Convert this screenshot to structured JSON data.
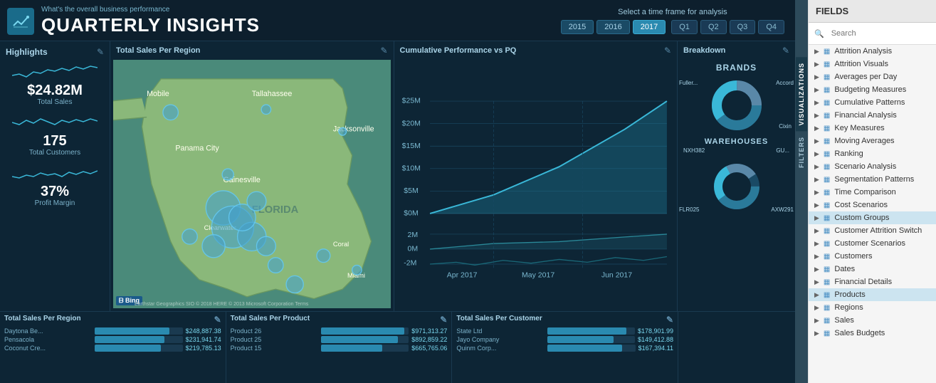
{
  "header": {
    "subtitle": "What's the overall business performance",
    "title": "QUARTERLY INSIGHTS",
    "logo_icon": "chart-icon"
  },
  "timeframe": {
    "label": "Select a time frame for analysis",
    "years": [
      "2015",
      "2016",
      "2017"
    ],
    "active_year": "2017",
    "quarters": [
      "Q1",
      "Q2",
      "Q3",
      "Q4"
    ]
  },
  "highlights": {
    "title": "Highlights",
    "metrics": [
      {
        "value": "$24.82M",
        "label": "Total Sales"
      },
      {
        "value": "175",
        "label": "Total Customers"
      },
      {
        "value": "37%",
        "label": "Profit Margin"
      }
    ]
  },
  "panels": {
    "total_sales_map": "Total Sales Per Region",
    "cumulative": "Cumulative Performance vs PQ",
    "breakdown": "Breakdown"
  },
  "brands": {
    "title": "BRANDS",
    "labels": [
      "Fuller...",
      "Accord",
      "Cixin"
    ]
  },
  "warehouses": {
    "title": "WAREHOUSES",
    "items": [
      {
        "id": "NXH382",
        "label": ""
      },
      {
        "id": "GU...",
        "label": ""
      },
      {
        "id": "FLR025",
        "label": "AXW291"
      }
    ]
  },
  "cumulative_chart": {
    "y_labels": [
      "$25M",
      "$20M",
      "$15M",
      "$10M",
      "$5M",
      "$0M",
      "2M",
      "0M",
      "-2M"
    ],
    "x_labels": [
      "Apr 2017",
      "May 2017",
      "Jun 2017"
    ]
  },
  "map_credit": "Earthstar Geographics SIO © 2018 HERE © 2013 Microsoft Corporation  Terms",
  "bottom": {
    "region": {
      "title": "Total Sales Per Region",
      "rows": [
        {
          "label": "Daytona Be...",
          "value": "$248,887.38",
          "pct": 85
        },
        {
          "label": "Pensacola",
          "value": "$231,941.74",
          "pct": 79
        },
        {
          "label": "Coconut Cre...",
          "value": "$219,785.13",
          "pct": 75
        }
      ]
    },
    "product": {
      "title": "Total Sales Per Product",
      "rows": [
        {
          "label": "Product 26",
          "value": "$971,313.27",
          "pct": 95
        },
        {
          "label": "Product 25",
          "value": "$892,859.22",
          "pct": 88
        },
        {
          "label": "Product 15",
          "value": "$665,765.06",
          "pct": 70
        }
      ]
    },
    "customer": {
      "title": "Total Sales Per Customer",
      "rows": [
        {
          "label": "State Ltd",
          "value": "$178,901.99",
          "pct": 90
        },
        {
          "label": "Jayo Company",
          "value": "$149,412.88",
          "pct": 76
        },
        {
          "label": "Quinm Corp...",
          "value": "$167,394.11",
          "pct": 85
        }
      ]
    }
  },
  "fields": {
    "header": "FIELDS",
    "search_placeholder": "Search",
    "items": [
      {
        "label": "Attrition Analysis",
        "highlighted": false
      },
      {
        "label": "Attrition Visuals",
        "highlighted": false
      },
      {
        "label": "Averages per Day",
        "highlighted": false
      },
      {
        "label": "Budgeting Measures",
        "highlighted": false
      },
      {
        "label": "Cumulative Patterns",
        "highlighted": false
      },
      {
        "label": "Financial Analysis",
        "highlighted": false
      },
      {
        "label": "Key Measures",
        "highlighted": false
      },
      {
        "label": "Moving Averages",
        "highlighted": false
      },
      {
        "label": "Ranking",
        "highlighted": false
      },
      {
        "label": "Scenario Analysis",
        "highlighted": false
      },
      {
        "label": "Segmentation Patterns",
        "highlighted": false
      },
      {
        "label": "Time Comparison",
        "highlighted": false
      },
      {
        "label": "Cost Scenarios",
        "highlighted": false
      },
      {
        "label": "Custom Groups",
        "highlighted": true
      },
      {
        "label": "Customer Attrition Switch",
        "highlighted": false
      },
      {
        "label": "Customer Scenarios",
        "highlighted": false
      },
      {
        "label": "Customers",
        "highlighted": false
      },
      {
        "label": "Dates",
        "highlighted": false
      },
      {
        "label": "Financial Details",
        "highlighted": false
      },
      {
        "label": "Products",
        "highlighted": true
      },
      {
        "label": "Regions",
        "highlighted": false
      },
      {
        "label": "Sales",
        "highlighted": false
      },
      {
        "label": "Sales Budgets",
        "highlighted": false
      }
    ]
  },
  "side_tabs": {
    "visualizations": "VISUALIZATIONS",
    "filters": "FILTERS"
  }
}
